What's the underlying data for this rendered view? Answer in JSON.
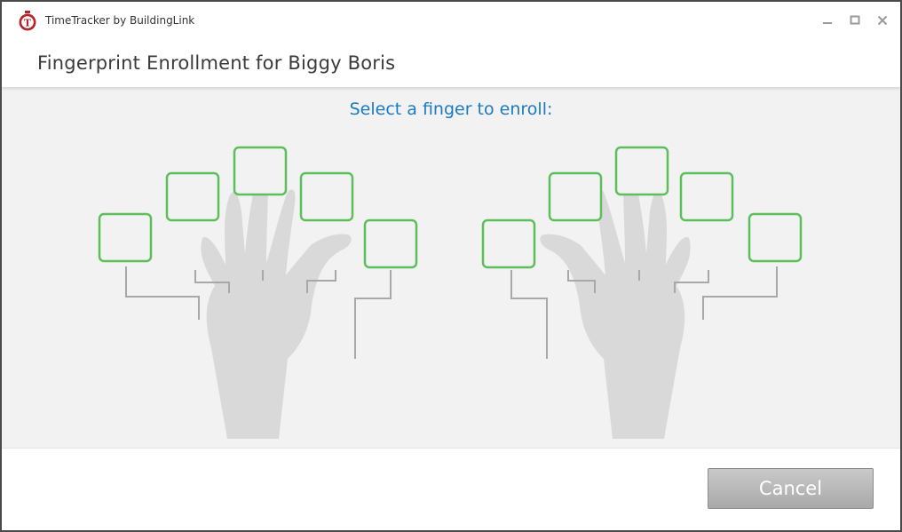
{
  "window": {
    "app_title": "TimeTracker by BuildingLink",
    "logo_letter": "T",
    "controls": {
      "minimize": "—",
      "maximize": "□",
      "close": "✕"
    }
  },
  "header": {
    "title": "Fingerprint Enrollment for Biggy Boris"
  },
  "main": {
    "prompt": "Select a finger to enroll:",
    "hands": [
      {
        "name": "left",
        "fingers": [
          "pinky",
          "ring",
          "middle",
          "index",
          "thumb"
        ]
      },
      {
        "name": "right",
        "fingers": [
          "thumb",
          "index",
          "middle",
          "ring",
          "pinky"
        ]
      }
    ]
  },
  "footer": {
    "cancel_label": "Cancel"
  },
  "colors": {
    "accent": "#1a7bc1",
    "box_border": "#5cbf5c",
    "hand": "#d9d9d9",
    "connector": "#a8a8a8",
    "logo": "#b3262d"
  }
}
